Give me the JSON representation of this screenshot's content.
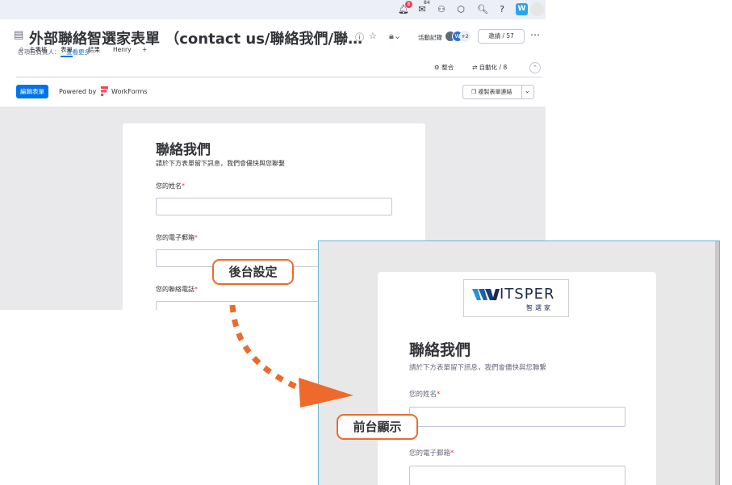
{
  "topbar": {
    "notification_count": "8",
    "inbox_count": "84",
    "brand_badge": "W",
    "icons": [
      "bell-icon",
      "inbox-icon",
      "invite-icon",
      "apps-icon",
      "search-icon",
      "help-icon"
    ]
  },
  "board": {
    "title": "外部聯絡智選家表單 （contact us/聯絡我們/聯…",
    "owner_label": "各項目負責人：",
    "owner_link": "查看更多",
    "activity_label": "活動記錄",
    "avatar_initial": "W",
    "avatar_more": "+2",
    "invite_label": "邀請 / 57",
    "tabs": [
      {
        "label": "主表格"
      },
      {
        "label": "表單"
      },
      {
        "label": "結果"
      },
      {
        "label": "Henry"
      },
      {
        "label": "+"
      }
    ],
    "integrate_label": "整合",
    "automate_label": "自動化 / 8"
  },
  "formbar": {
    "edit_button": "編輯表單",
    "powered_by": "Powered by",
    "workforms": "WorkForms",
    "copy_link": "複製表單連結"
  },
  "backend_form": {
    "title": "聯絡我們",
    "description": "請於下方表單留下訊息，我們會儘快與您聯繫",
    "fields": [
      {
        "label": "您的姓名"
      },
      {
        "label": "您的電子郵箱"
      },
      {
        "label": "您的聯絡電話"
      }
    ],
    "required_mark": "*"
  },
  "frontend_form": {
    "logo_text": "ITSPER",
    "logo_sub": "智選家",
    "title": "聯絡我們",
    "description": "請於下方表單留下訊息，我們會儘快與您聯繫",
    "fields": [
      {
        "label": "您的姓名"
      },
      {
        "label": "您的電子郵箱"
      }
    ],
    "required_mark": "*"
  },
  "annotations": {
    "backend_label": "後台設定",
    "frontend_label": "前台顯示",
    "arrow_color": "#ee6a2c"
  },
  "colors": {
    "accent": "#0073ea",
    "required": "#d83a52",
    "annotation": "#ee6a2c"
  }
}
